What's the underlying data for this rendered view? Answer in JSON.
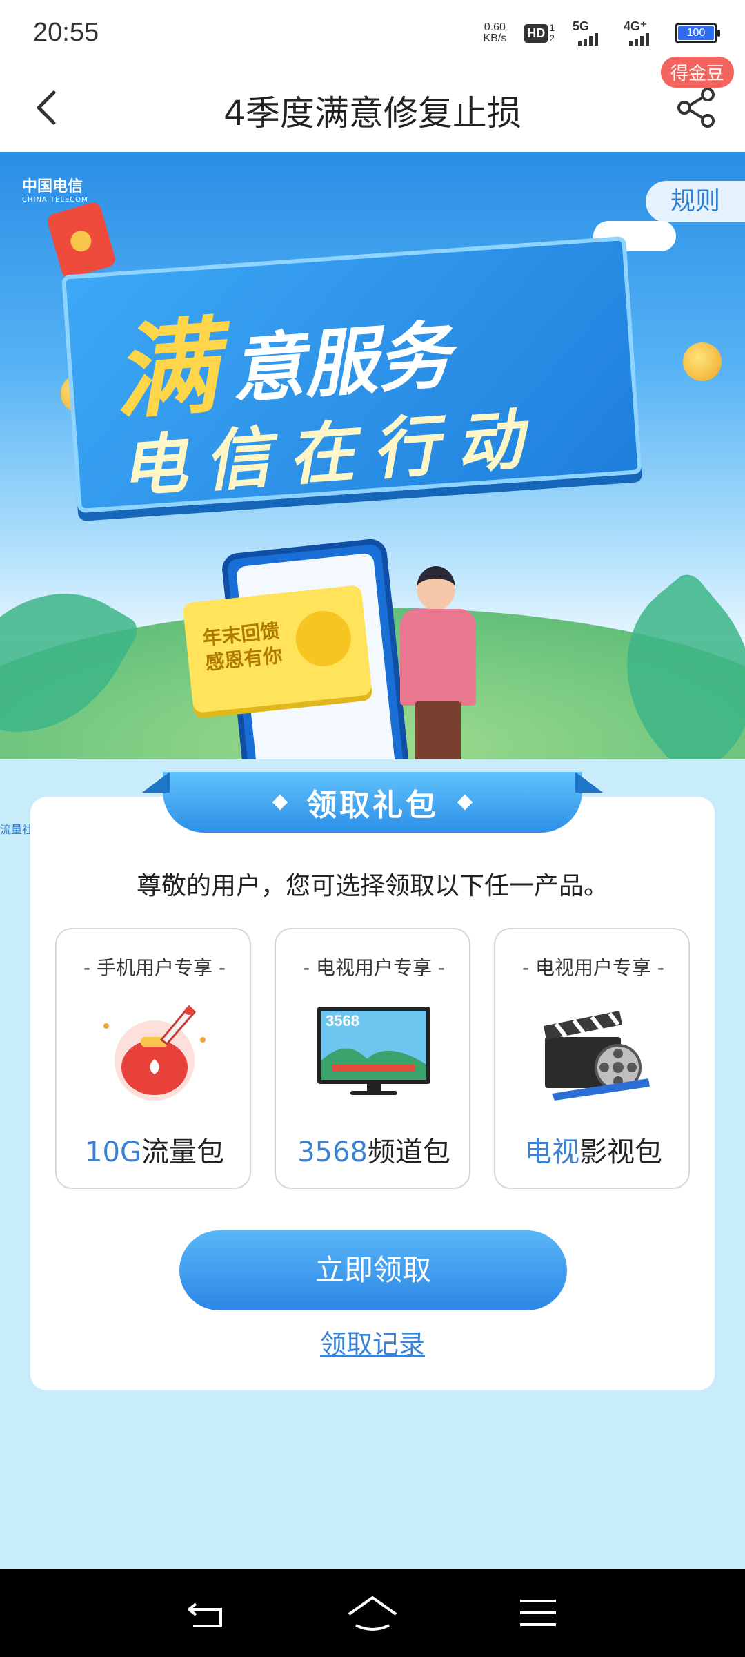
{
  "status": {
    "time": "20:55",
    "netspeed_value": "0.60",
    "netspeed_unit": "KB/s",
    "hd_label": "HD",
    "hd_sim1": "1",
    "hd_sim2": "2",
    "sig1_label": "5G",
    "sig2_label": "4G⁺",
    "battery": "100"
  },
  "header": {
    "title": "4季度满意修复止损",
    "coin_badge": "得金豆"
  },
  "banner": {
    "logo_cn": "中国电信",
    "logo_en": "CHINA TELECOM",
    "rules_label": "规则",
    "headline_big": "满",
    "headline_rest": "意服务",
    "headline_line2": "电信在行动",
    "card_line1": "年末回馈",
    "card_line2": "感恩有你"
  },
  "side_tag": "流量社区",
  "gift": {
    "ribbon_title": "领取礼包",
    "intro": "尊敬的用户，您可选择领取以下任一产品。",
    "products": [
      {
        "tag": "- 手机用户专享 -",
        "name_highlight": "10G",
        "name_rest": "流量包",
        "icon": "rocket-red-bag-icon"
      },
      {
        "tag": "- 电视用户专享 -",
        "name_highlight": "3568",
        "name_rest": "频道包",
        "screen_text": "3568",
        "icon": "tv-icon"
      },
      {
        "tag": "- 电视用户专享 -",
        "name_highlight": "电视",
        "name_rest": "影视包",
        "icon": "clapperboard-icon"
      }
    ],
    "claim_button": "立即领取",
    "records_link": "领取记录"
  },
  "colors": {
    "accent_blue": "#3a82d6",
    "button_gradient_top": "#59b6f7",
    "button_gradient_bottom": "#2c87e6",
    "badge_red": "#f2645d",
    "page_bg": "#c9ecfb"
  }
}
